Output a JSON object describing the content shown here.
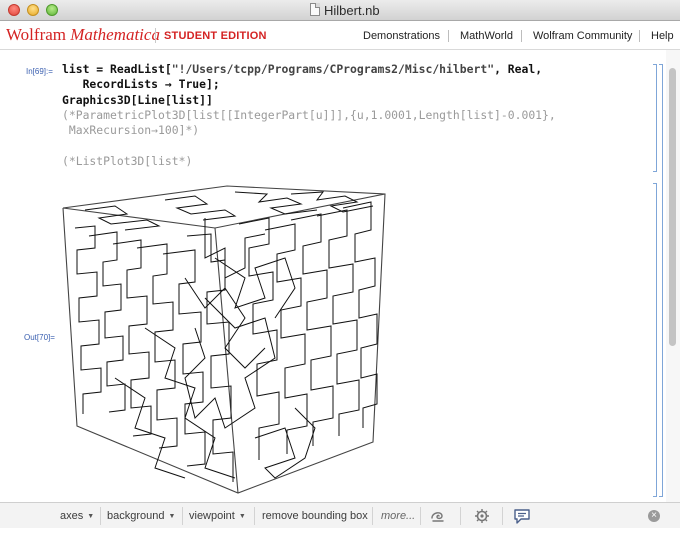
{
  "window": {
    "title": "Hilbert.nb"
  },
  "banner": {
    "brand_first": "Wolfram",
    "brand_product": "Mathematica",
    "edition": "STUDENT EDITION",
    "links": [
      "Demonstrations",
      "MathWorld",
      "Wolfram Community",
      "Help"
    ]
  },
  "notebook": {
    "input_label": "In[69]:=",
    "output_label": "Out[70]=",
    "code_line1_a": "list = ReadList[",
    "code_line1_str": "\"!/Users/tcpp/Programs/CPrograms2/Misc/hilbert\"",
    "code_line1_b": ", Real,",
    "code_line2": "   RecordLists → True];",
    "code_line3": "Graphics3D[Line[list]]",
    "comment_line1": "(*ParametricPlot3D[list[[IntegerPart[u]]],{u,1.0001,Length[list]-0.001},",
    "comment_line2": " MaxRecursion→100]*)",
    "comment_line3": "(*ListPlot3D[list*)"
  },
  "toolbar": {
    "axes": "axes",
    "background": "background",
    "viewpoint": "viewpoint",
    "remove_bbox": "remove bounding box",
    "more": "more...",
    "close": "×"
  },
  "colors": {
    "brand": "#d42323",
    "cell_label": "#3a5fb0",
    "bracket": "#7fa6d8"
  }
}
